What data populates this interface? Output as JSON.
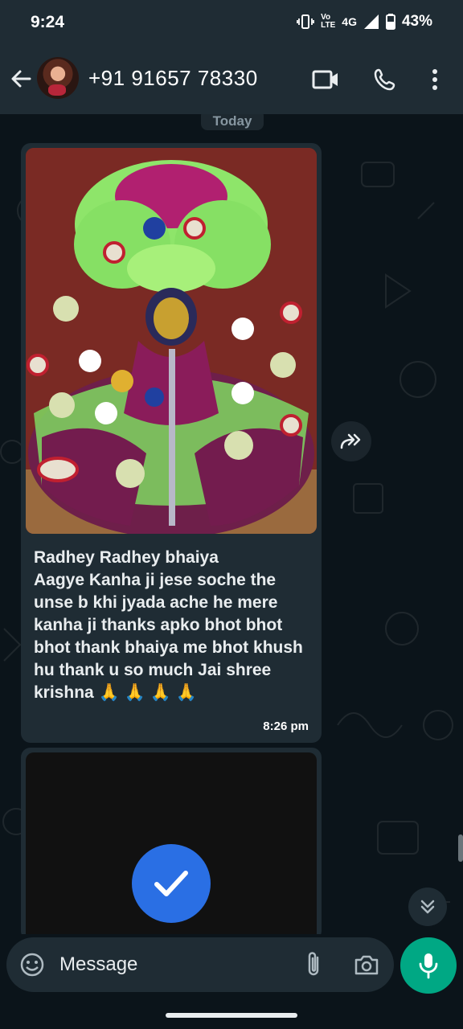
{
  "status_bar": {
    "time": "9:24",
    "volte_label": "Vo\nLTE",
    "network": "4G",
    "battery": "43%"
  },
  "header": {
    "contact_name": "+91 91657 78330",
    "icons": [
      "back-arrow-icon",
      "video-call-icon",
      "phone-icon",
      "more-vert-icon"
    ]
  },
  "chat": {
    "date_chip": "Today",
    "messages": [
      {
        "type": "image",
        "caption": "Radhey Radhey bhaiya\nAagye Kanha ji jese soche the unse b khi jyada ache he mere kanha ji thanks apko bhot bhot bhot thank bhaiya me bhot khush hu thank u so much Jai shree krishna 🙏 🙏 🙏 🙏",
        "time": "8:26 pm"
      },
      {
        "type": "video"
      }
    ]
  },
  "composer": {
    "placeholder": "Message",
    "icons": [
      "emoji-icon",
      "attach-icon",
      "camera-icon",
      "mic-icon"
    ]
  },
  "colors": {
    "header_bg": "#1f2c34",
    "chat_bg": "#0b141a",
    "bubble_bg": "#1f2c34",
    "accent_green": "#00a884",
    "check_blue": "#2a6fe4"
  }
}
